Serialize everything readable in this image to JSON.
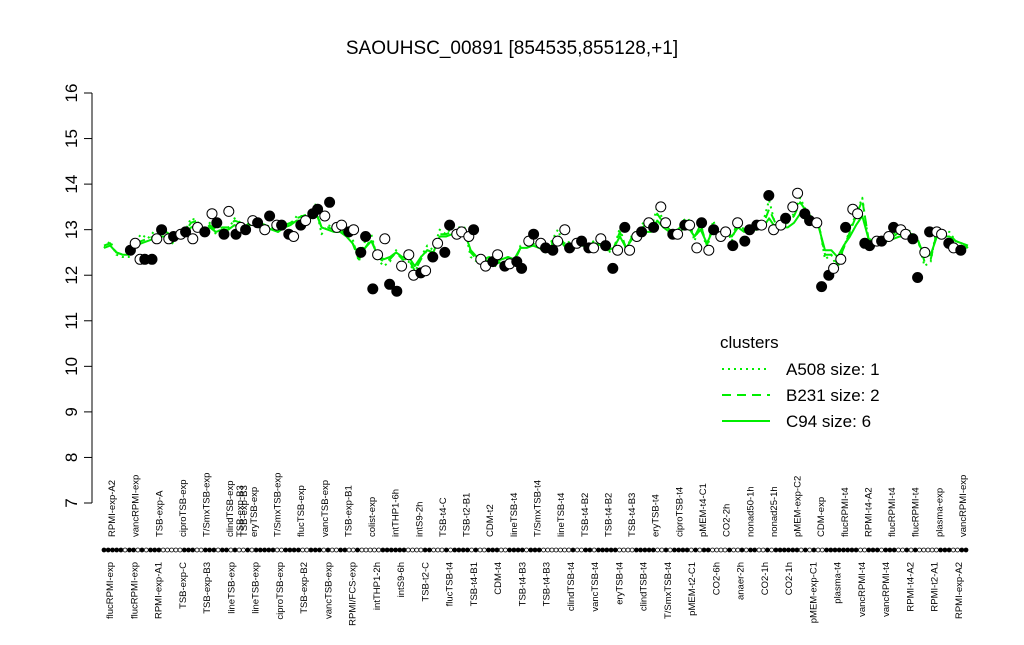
{
  "chart_data": {
    "type": "line",
    "title": "SAOUHSC_00891 [854535,855128,+1]",
    "xlabel": "",
    "ylabel": "",
    "ylim": [
      7,
      16
    ],
    "yticks": [
      7,
      8,
      9,
      10,
      11,
      12,
      13,
      14,
      15,
      16
    ],
    "grid": false,
    "top_labels": [
      "RPMI-exp-A2",
      "vancRPMI-exp",
      "TSB-exp-A",
      "ciproTSB-exp",
      "T/SmxTSB-exp",
      "clindTSB-exp",
      "eryTSB-exp",
      "T/SmxTSB-exp",
      "flucTSB-exp",
      "vancTSB-exp",
      "TSB-exp-B1",
      "colist-exp",
      "intTHP1-6h",
      "intS9-2h",
      "TSB-t4-C",
      "TSB-t2-B1",
      "CDM-t2",
      "lineTSB-t4",
      "T/SmxTSB-t4",
      "lineTSB-t4",
      "TSB-t4-B2",
      "TSB-t4-B2",
      "TSB-t4-B3",
      "eryTSB-t4",
      "ciproTSB-t4",
      "pMEM-t4-C1",
      "CO2-2h",
      "nonad50-1h",
      "nonad25-1h",
      "pMEM-exp-C2",
      "CDM-exp",
      "flucRPMI-t4",
      "RPMI-t4-A2",
      "flucRPMI-t4",
      "flucRPMI-t4",
      "plasma-exp",
      "vancRPMI-exp"
    ],
    "bottom_labels": [
      "flucRPMI-exp",
      "flucRPMI-exp",
      "RPMI-exp-A1",
      "TSB-exp-C",
      "TSB-exp-B3",
      "lineTSB-exp",
      "lineTSB-exp",
      "ciproTSB-exp",
      "TSB-exp-B2",
      "vancTSB-exp",
      "RPMI/FCS-exp",
      "intTHP1-2h",
      "intS9-6h",
      "TSB-t2-C",
      "flucTSB-t4",
      "TSB-t4-B1",
      "CDM-t4",
      "TSB-t4-B3",
      "TSB-t4-B3",
      "clindTSB-t4",
      "vancTSB-t4",
      "eryTSB-t4",
      "clindTSB-t4",
      "T/SmxTSB-t4",
      "pMEM-t2-C1",
      "CO2-6h",
      "anaer-2h",
      "CO2-1h",
      "CO2-1h",
      "pMEM-exp-C1",
      "plasma-t4",
      "vancRPMI-t4",
      "vancRPMI-t4",
      "RPMI-t4-A2",
      "RPMI-t2-A1",
      "RPMI-exp-A2"
    ],
    "overlay_labels": [
      "TSB-exp-B3",
      "TSB-exp-B3"
    ],
    "strip_dots": "1111101101011100000111001110110100101111100111100111010011001000001111110000110001011110100111001111011100000001001101111100001111100101111010110000100101100101111110101001111111100111011100101000001110011",
    "series": [
      {
        "name": "A508 size: 1",
        "values": [
          12.6,
          12.75,
          12.45,
          12.4,
          12.4,
          12.75,
          12.9,
          12.8,
          12.95,
          12.95,
          13.0,
          12.7,
          12.95,
          12.95,
          13.25,
          13.2,
          12.85,
          13.15,
          12.9,
          13.05,
          13.0,
          13.25,
          13.15,
          13.05,
          13.3,
          13.1,
          13.1,
          13.05,
          12.95,
          13.05,
          13.1,
          13.3,
          13.3,
          13.25,
          13.55,
          12.9,
          13.1,
          13.05,
          13.05,
          12.9,
          12.8,
          12.3,
          12.75,
          12.9,
          12.35,
          12.2,
          12.3,
          12.55,
          12.35,
          12.3,
          12.05,
          12.4,
          12.65,
          12.55,
          13.0,
          12.9,
          13.05,
          13.05,
          13.05,
          12.4,
          12.3,
          12.25,
          12.35,
          12.2,
          12.25,
          12.3,
          12.2,
          12.65,
          12.7,
          12.7,
          12.6,
          12.5,
          12.75,
          13.0,
          12.65,
          12.75,
          12.75,
          12.7,
          12.6,
          12.8,
          12.65,
          12.5,
          12.55,
          13.05,
          12.55,
          12.9,
          13.0,
          13.2,
          13.0,
          13.5,
          13.2,
          12.95,
          12.9,
          13.2,
          13.25,
          12.75,
          13.15,
          12.55,
          13.2,
          12.85,
          13.05,
          12.75,
          13.25,
          12.95,
          13.05,
          13.05,
          13.15,
          13.65,
          13.1,
          13.05,
          13.2,
          13.35,
          13.7,
          13.4,
          13.25,
          13.15,
          12.35,
          12.45,
          12.15,
          12.6,
          13.0,
          13.35,
          13.7,
          12.75,
          12.7,
          12.75,
          12.8,
          12.9,
          13.05,
          13.0,
          12.95,
          12.75,
          12.2,
          12.3,
          13.05,
          12.95,
          12.95,
          12.75,
          12.7,
          12.55
        ]
      },
      {
        "name": "B231 size: 2",
        "values": [
          12.65,
          12.7,
          12.5,
          12.45,
          12.45,
          12.7,
          12.75,
          12.8,
          12.85,
          12.9,
          12.95,
          12.85,
          12.9,
          12.95,
          13.15,
          13.2,
          12.95,
          13.1,
          13.0,
          13.05,
          13.05,
          13.2,
          13.15,
          13.1,
          13.25,
          13.15,
          13.1,
          13.05,
          13.0,
          13.1,
          13.15,
          13.25,
          13.3,
          13.35,
          13.45,
          13.05,
          13.05,
          13.0,
          13.0,
          12.9,
          12.7,
          12.35,
          12.6,
          12.8,
          12.4,
          12.3,
          12.35,
          12.5,
          12.35,
          12.35,
          12.1,
          12.35,
          12.55,
          12.5,
          12.9,
          12.9,
          12.95,
          13.0,
          13.0,
          12.5,
          12.35,
          12.3,
          12.35,
          12.25,
          12.3,
          12.35,
          12.3,
          12.6,
          12.65,
          12.7,
          12.6,
          12.55,
          12.7,
          12.9,
          12.7,
          12.7,
          12.7,
          12.7,
          12.65,
          12.75,
          12.7,
          12.55,
          12.6,
          12.95,
          12.6,
          12.85,
          12.95,
          13.1,
          13.0,
          13.35,
          13.15,
          13.0,
          12.95,
          13.1,
          13.15,
          12.85,
          13.1,
          12.65,
          13.1,
          12.9,
          13.0,
          12.85,
          13.15,
          13.0,
          13.05,
          13.05,
          13.1,
          13.45,
          13.15,
          13.1,
          13.15,
          13.3,
          13.6,
          13.4,
          13.25,
          13.1,
          12.45,
          12.45,
          12.25,
          12.6,
          12.95,
          13.3,
          13.65,
          12.8,
          12.75,
          12.75,
          12.8,
          12.85,
          12.95,
          12.95,
          12.9,
          12.75,
          12.3,
          12.35,
          12.95,
          12.9,
          12.9,
          12.75,
          12.7,
          12.6
        ]
      },
      {
        "name": "C94 size: 6",
        "values": [
          12.6,
          12.65,
          12.5,
          12.45,
          12.45,
          12.65,
          12.7,
          12.75,
          12.8,
          12.85,
          12.85,
          12.8,
          12.85,
          12.9,
          13.05,
          13.1,
          12.95,
          13.05,
          12.95,
          13.0,
          13.0,
          13.1,
          13.05,
          13.05,
          13.15,
          13.05,
          13.05,
          13.0,
          12.95,
          13.05,
          13.1,
          13.2,
          13.2,
          13.2,
          13.4,
          13.05,
          13.0,
          12.95,
          12.95,
          12.85,
          12.7,
          12.45,
          12.6,
          12.75,
          12.45,
          12.35,
          12.4,
          12.5,
          12.4,
          12.4,
          12.2,
          12.4,
          12.55,
          12.5,
          12.85,
          12.85,
          12.9,
          12.95,
          12.95,
          12.55,
          12.4,
          12.35,
          12.4,
          12.3,
          12.35,
          12.4,
          12.35,
          12.6,
          12.6,
          12.65,
          12.6,
          12.55,
          12.65,
          12.85,
          12.65,
          12.65,
          12.65,
          12.65,
          12.6,
          12.7,
          12.65,
          12.55,
          12.6,
          12.85,
          12.6,
          12.8,
          12.85,
          12.95,
          12.95,
          13.2,
          13.05,
          12.95,
          12.9,
          13.0,
          13.05,
          12.85,
          13.0,
          12.7,
          13.0,
          12.85,
          12.95,
          12.85,
          13.05,
          12.95,
          13.0,
          13.0,
          13.05,
          13.25,
          13.05,
          13.05,
          13.05,
          13.15,
          13.35,
          13.2,
          13.15,
          13.05,
          12.55,
          12.55,
          12.4,
          12.65,
          12.85,
          13.1,
          13.3,
          12.8,
          12.75,
          12.75,
          12.75,
          12.8,
          12.85,
          12.85,
          12.85,
          12.75,
          12.4,
          12.45,
          12.85,
          12.85,
          12.85,
          12.75,
          12.7,
          12.65
        ]
      }
    ],
    "points": {
      "x": [
        11,
        13,
        15,
        17,
        20,
        22,
        24,
        27,
        29,
        32,
        34,
        37,
        39,
        42,
        45,
        47,
        50,
        52,
        55,
        57,
        59,
        62,
        64,
        67,
        69,
        72,
        74,
        77,
        79,
        82,
        84,
        87,
        89,
        92,
        94,
        97,
        99,
        102,
        104,
        107,
        109,
        112,
        114,
        117,
        119,
        122,
        124,
        127,
        129,
        132,
        134,
        137,
        139,
        142,
        144,
        147,
        149,
        152,
        154,
        157,
        159,
        162,
        164,
        167,
        169,
        172,
        174,
        177,
        179,
        182,
        184,
        187,
        189,
        192,
        194,
        197,
        199,
        202,
        204,
        207,
        209,
        212,
        214,
        217,
        219,
        222,
        224,
        227,
        229,
        232,
        234,
        237,
        239,
        242,
        244,
        247,
        249,
        252,
        254,
        257,
        259,
        262,
        264,
        267,
        269,
        272,
        274,
        277,
        279,
        282,
        284,
        287,
        289,
        292,
        294,
        297,
        299,
        302,
        304,
        307,
        309,
        312,
        314,
        317,
        319,
        322,
        324,
        327,
        329,
        332,
        334,
        337,
        339,
        342,
        344,
        347,
        349,
        352,
        354,
        357
      ],
      "y": [
        12.55,
        12.7,
        12.35,
        12.35,
        12.35,
        12.8,
        13.0,
        12.8,
        12.85,
        12.9,
        12.95,
        12.8,
        13.05,
        12.95,
        13.35,
        13.15,
        12.9,
        13.4,
        12.9,
        13.05,
        13.0,
        13.2,
        13.15,
        13.0,
        13.3,
        13.1,
        13.1,
        12.9,
        12.85,
        13.1,
        13.2,
        13.35,
        13.45,
        13.3,
        13.6,
        13.05,
        13.1,
        12.95,
        13.0,
        12.5,
        12.85,
        11.7,
        12.45,
        12.8,
        11.8,
        11.65,
        12.2,
        12.45,
        12.0,
        12.05,
        12.1,
        12.4,
        12.7,
        12.5,
        13.1,
        12.9,
        12.95,
        12.85,
        13.0,
        12.35,
        12.2,
        12.3,
        12.45,
        12.2,
        12.25,
        12.3,
        12.15,
        12.75,
        12.9,
        12.7,
        12.6,
        12.55,
        12.75,
        13.0,
        12.6,
        12.7,
        12.75,
        12.6,
        12.6,
        12.8,
        12.65,
        12.15,
        12.55,
        13.05,
        12.55,
        12.85,
        12.95,
        13.15,
        13.05,
        13.5,
        13.15,
        12.9,
        12.9,
        13.1,
        13.1,
        12.6,
        13.15,
        12.55,
        13.0,
        12.85,
        12.95,
        12.65,
        13.15,
        12.75,
        13.0,
        13.1,
        13.1,
        13.75,
        13.0,
        13.1,
        13.25,
        13.5,
        13.8,
        13.35,
        13.2,
        13.15,
        11.75,
        12.0,
        12.15,
        12.35,
        13.05,
        13.45,
        13.35,
        12.7,
        12.65,
        12.75,
        12.75,
        12.85,
        13.05,
        13.0,
        12.9,
        12.8,
        11.95,
        12.5,
        12.95,
        12.95,
        12.9,
        12.7,
        12.6,
        12.55
      ],
      "filled": [
        1,
        0,
        0,
        1,
        1,
        0,
        1,
        0,
        1,
        0,
        1,
        0,
        0,
        1,
        0,
        1,
        1,
        0,
        1,
        0,
        1,
        0,
        1,
        0,
        1,
        0,
        1,
        1,
        0,
        1,
        0,
        1,
        1,
        0,
        1,
        0,
        0,
        1,
        0,
        1,
        1,
        1,
        0,
        0,
        1,
        1,
        0,
        0,
        0,
        1,
        0,
        1,
        0,
        1,
        1,
        0,
        0,
        0,
        1,
        0,
        0,
        1,
        0,
        1,
        0,
        1,
        1,
        0,
        1,
        0,
        1,
        1,
        0,
        0,
        1,
        0,
        1,
        1,
        0,
        0,
        1,
        1,
        0,
        1,
        0,
        0,
        1,
        0,
        1,
        0,
        0,
        1,
        0,
        1,
        0,
        0,
        1,
        0,
        1,
        0,
        0,
        1,
        0,
        1,
        1,
        1,
        0,
        1,
        0,
        0,
        1,
        0,
        0,
        1,
        1,
        0,
        1,
        1,
        0,
        0,
        1,
        0,
        0,
        1,
        1,
        0,
        1,
        0,
        1,
        0,
        0,
        1,
        1,
        0,
        1,
        0,
        0,
        1,
        0,
        1
      ],
      "xrange": [
        0,
        360
      ]
    },
    "legend": {
      "title": "clusters",
      "placement": "right",
      "entries": [
        "A508 size: 1",
        "B231 size: 2",
        "C94 size: 6"
      ]
    },
    "colors": {
      "series": "#00ee00",
      "marks": "#000000"
    }
  }
}
